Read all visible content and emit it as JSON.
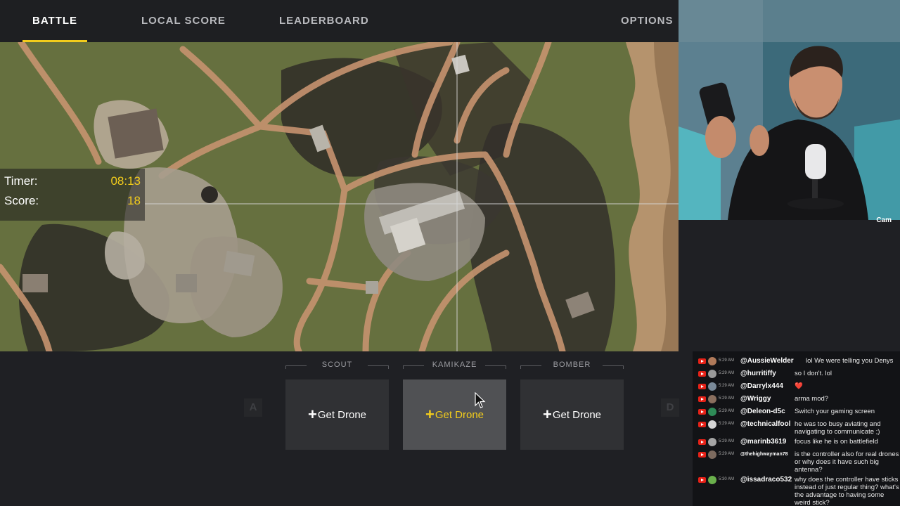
{
  "nav": {
    "tabs": [
      "BATTLE",
      "LOCAL SCORE",
      "LEADERBOARD"
    ],
    "options": "OPTIONS",
    "active": "BATTLE"
  },
  "hud": {
    "timer_label": "Timer:",
    "timer_value": "08:13",
    "score_label": "Score:",
    "score_value": "18"
  },
  "cam": {
    "label": "Cam"
  },
  "drones": [
    {
      "type": "SCOUT",
      "action": "Get Drone",
      "selected": false
    },
    {
      "type": "KAMIKAZE",
      "action": "Get Drone",
      "selected": true
    },
    {
      "type": "BOMBER",
      "action": "Get Drone",
      "selected": false
    }
  ],
  "keys": {
    "left": "A",
    "right": "D"
  },
  "colors": {
    "accent": "#f2cc1c",
    "youtube": "#e62117"
  },
  "chat": [
    {
      "time": "5:29 AM",
      "user": "@AussieWelder",
      "text": "lol We were telling you Denys"
    },
    {
      "time": "5:29 AM",
      "user": "@hurritiffy",
      "text": "so I don't. lol"
    },
    {
      "time": "5:29 AM",
      "user": "@Darrylx444",
      "text": "❤️"
    },
    {
      "time": "5:29 AM",
      "user": "@Wriggy",
      "text": "arma mod?"
    },
    {
      "time": "5:29 AM",
      "user": "@Deleon-d5c",
      "text": "Switch your gaming screen"
    },
    {
      "time": "5:29 AM",
      "user": "@technicalfool",
      "text": "he was too busy aviating and navigating to communicate ;)"
    },
    {
      "time": "5:29 AM",
      "user": "@marinb3619",
      "text": "focus like he is on battlefield"
    },
    {
      "time": "5:29 AM",
      "user": "@thehighwayman78",
      "text": "is the controller also for real drones or why does it have such big antenna?"
    },
    {
      "time": "5:30 AM",
      "user": "@issadraco532",
      "text": "why does the controller have sticks instead of just regular thing? what's the advantage to having some weird stick?"
    }
  ]
}
